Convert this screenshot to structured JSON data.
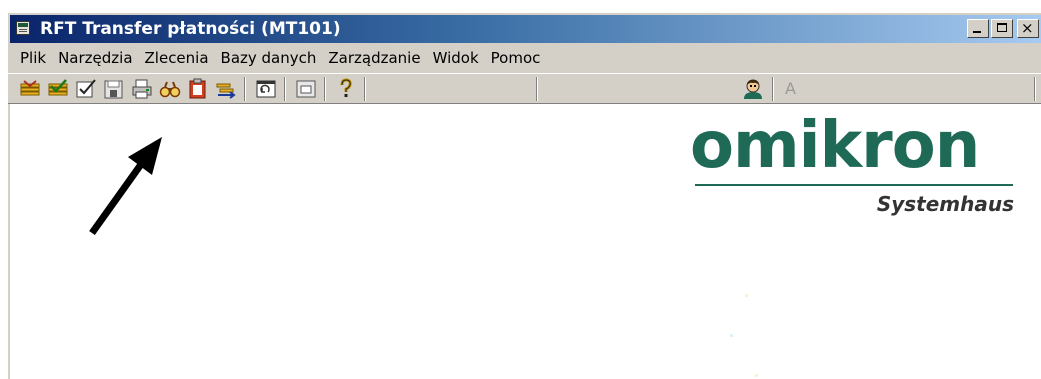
{
  "window": {
    "title": "RFT Transfer płatności (MT101)",
    "controls": {
      "minimize": "_",
      "maximize": "□",
      "close": "×"
    }
  },
  "menu": {
    "items": [
      "Plik",
      "Narzędzia",
      "Zlecenia",
      "Bazy danych",
      "Zarządzanie",
      "Widok",
      "Pomoc"
    ]
  },
  "toolbar": {
    "buttons": [
      {
        "icon": "import-orders-icon"
      },
      {
        "icon": "verify-orders-icon"
      },
      {
        "icon": "approve-icon"
      },
      {
        "icon": "floppy-save-icon"
      },
      {
        "icon": "print-icon"
      },
      {
        "icon": "binoculars-icon"
      },
      {
        "icon": "clipboard-icon"
      },
      {
        "icon": "transfer-icon"
      },
      {
        "icon": "refresh-window-icon"
      },
      {
        "icon": "window-icon"
      },
      {
        "icon": "help-icon"
      },
      {
        "icon": "user-icon"
      }
    ],
    "status_letter": "A"
  },
  "logo": {
    "word": "omikron",
    "tagline": "Systemhaus",
    "color": "#1f6a56"
  },
  "annotation": {
    "arrow_target": "floppy-save-icon",
    "color": "#000000"
  }
}
